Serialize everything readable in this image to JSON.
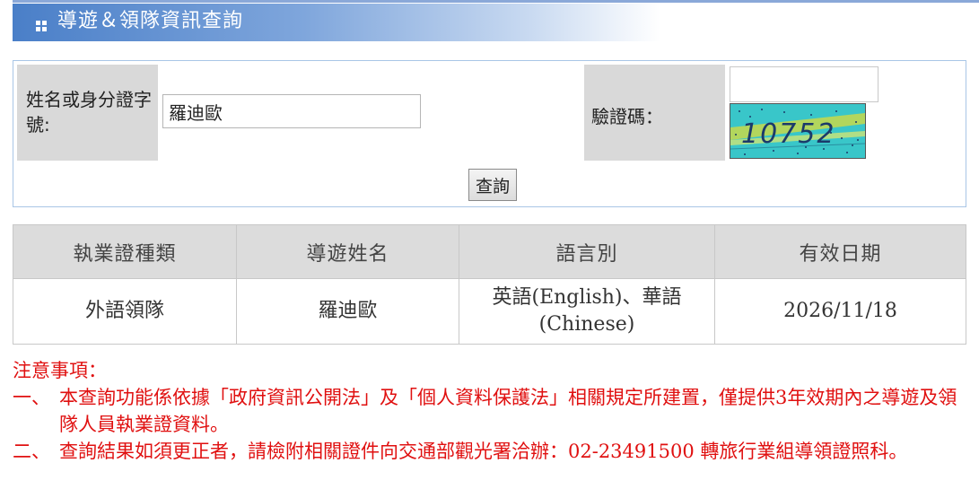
{
  "header": {
    "title": "導遊＆領隊資訊查詢",
    "icon": "grid-bullet-icon"
  },
  "search": {
    "name_label": "姓名或身分證字號:",
    "name_value": "羅迪歐",
    "captcha_label": "驗證碼：",
    "captcha_value": "",
    "captcha_code": "10752",
    "query_button": "查詢"
  },
  "results": {
    "columns": [
      "執業證種類",
      "導遊姓名",
      "語言別",
      "有效日期"
    ],
    "rows": [
      [
        "外語領隊",
        "羅迪歐",
        "英語(English)、華語(Chinese)",
        "2026/11/18"
      ]
    ]
  },
  "notes": {
    "title": "注意事項：",
    "items": [
      {
        "marker": "一、",
        "text": "本查詢功能係依據「政府資訊公開法」及「個人資料保護法」相關規定所建置，僅提供3年效期內之導遊及領隊人員執業證資料。"
      },
      {
        "marker": "二、",
        "text": "查詢結果如須更正者，請檢附相關證件向交通部觀光署洽辦：02-23491500 轉旅行業組導領證照科。"
      }
    ]
  },
  "colors": {
    "header_start": "#4a7fc8",
    "header_end": "#ffffff",
    "label_bg": "#d9d9d9",
    "table_header_bg": "#dcdcdc",
    "notes_text": "#e01010",
    "search_border": "#a9c6e6"
  }
}
